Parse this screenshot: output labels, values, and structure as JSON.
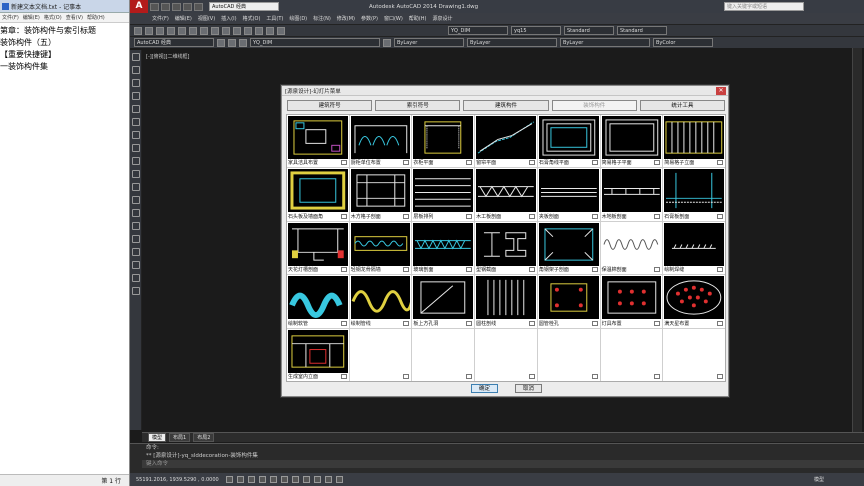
{
  "notepad": {
    "title": "新建文本文档.txt - 记事本",
    "menu": [
      "文件(F)",
      "编辑(E)",
      "格式(O)",
      "查看(V)",
      "帮助(H)"
    ],
    "lines": [
      "第章：装饰构件与索引标题",
      "装饰构件（五）",
      "【重要快捷键】",
      "一装饰构件集"
    ],
    "status": "第 1 行"
  },
  "cad": {
    "title": "Autodesk AutoCAD 2014    Drawing1.dwg",
    "workspace": "AutoCAD 经典",
    "search_placeholder": "键入关键字或短语",
    "menu": [
      "文件(F)",
      "编辑(E)",
      "视图(V)",
      "插入(I)",
      "格式(O)",
      "工具(T)",
      "绘图(D)",
      "标注(N)",
      "修改(M)",
      "参数(P)",
      "窗口(W)",
      "帮助(H)",
      "源泉设计"
    ],
    "tb1_combos": [
      "YQ_DIM",
      "yq15",
      "Standard",
      "Standard"
    ],
    "tb2_combos": [
      "AutoCAD 经典",
      "YQ_DIM",
      "ByLayer",
      "ByLayer",
      "ByLayer",
      "ByColor"
    ],
    "viewport_label": "[-][俯视][二维线框]",
    "layout_tabs": [
      "模型",
      "布局1",
      "布局2"
    ],
    "command_lines": [
      "命令:",
      "** [源泉设计]-yq_slddecoration-装饰构件集",
      "键入命令"
    ],
    "coords": "55191.2016, 1939.5290 , 0.0000",
    "model_label": "模型"
  },
  "dialog": {
    "title": "[源泉设计]-幻灯片菜单",
    "tabs": [
      "建筑符号",
      "索引符号",
      "建筑构件",
      "装饰构件",
      "统计工具"
    ],
    "active_tab": "装饰构件",
    "items": [
      {
        "label": "家具洁具布置",
        "thumb": "furniture"
      },
      {
        "label": "厨柜单位布置",
        "thumb": "cabinet"
      },
      {
        "label": "衣柜平面",
        "thumb": "wardrobe"
      },
      {
        "label": "窗帘平面",
        "thumb": "curtain"
      },
      {
        "label": "石膏角线平面",
        "thumb": "molding"
      },
      {
        "label": "简易格子平面",
        "thumb": "grid"
      },
      {
        "label": "简易格子立面",
        "thumb": "grid-elev"
      },
      {
        "label": "石头板及墙面角",
        "thumb": "stone"
      },
      {
        "label": "木方格子剖面",
        "thumb": "timber"
      },
      {
        "label": "层板排列",
        "thumb": "shelves"
      },
      {
        "label": "木工板剖面",
        "thumb": "board"
      },
      {
        "label": "夹板剖面",
        "thumb": "plywood"
      },
      {
        "label": "木地板剖面",
        "thumb": "floor"
      },
      {
        "label": "石膏板剖面",
        "thumb": "gypsum"
      },
      {
        "label": "天花灯槽剖面",
        "thumb": "ceiling"
      },
      {
        "label": "轻钢龙骨隔墙",
        "thumb": "steel"
      },
      {
        "label": "玻璃剖面",
        "thumb": "glass"
      },
      {
        "label": "型钢截面",
        "thumb": "profile"
      },
      {
        "label": "角钢架子剖面",
        "thumb": "angle"
      },
      {
        "label": "保温棉剖面",
        "thumb": "insulation"
      },
      {
        "label": "绘制焊缝",
        "thumb": "weld"
      },
      {
        "label": "绘制软管",
        "thumb": "hose"
      },
      {
        "label": "绘制管线",
        "thumb": "pipe"
      },
      {
        "label": "板上方孔洞",
        "thumb": "hole"
      },
      {
        "label": "圆柱剖线",
        "thumb": "column"
      },
      {
        "label": "圆管栓孔",
        "thumb": "bolt"
      },
      {
        "label": "灯具布置",
        "thumb": "lamp"
      },
      {
        "label": "满天星布置",
        "thumb": "stars"
      },
      {
        "label": "生成室内立面",
        "thumb": "elevation"
      },
      {
        "label": "",
        "thumb": ""
      },
      {
        "label": "",
        "thumb": ""
      },
      {
        "label": "",
        "thumb": ""
      },
      {
        "label": "",
        "thumb": ""
      },
      {
        "label": "",
        "thumb": ""
      },
      {
        "label": "",
        "thumb": ""
      }
    ],
    "ok_label": "确定",
    "cancel_label": "取消"
  }
}
